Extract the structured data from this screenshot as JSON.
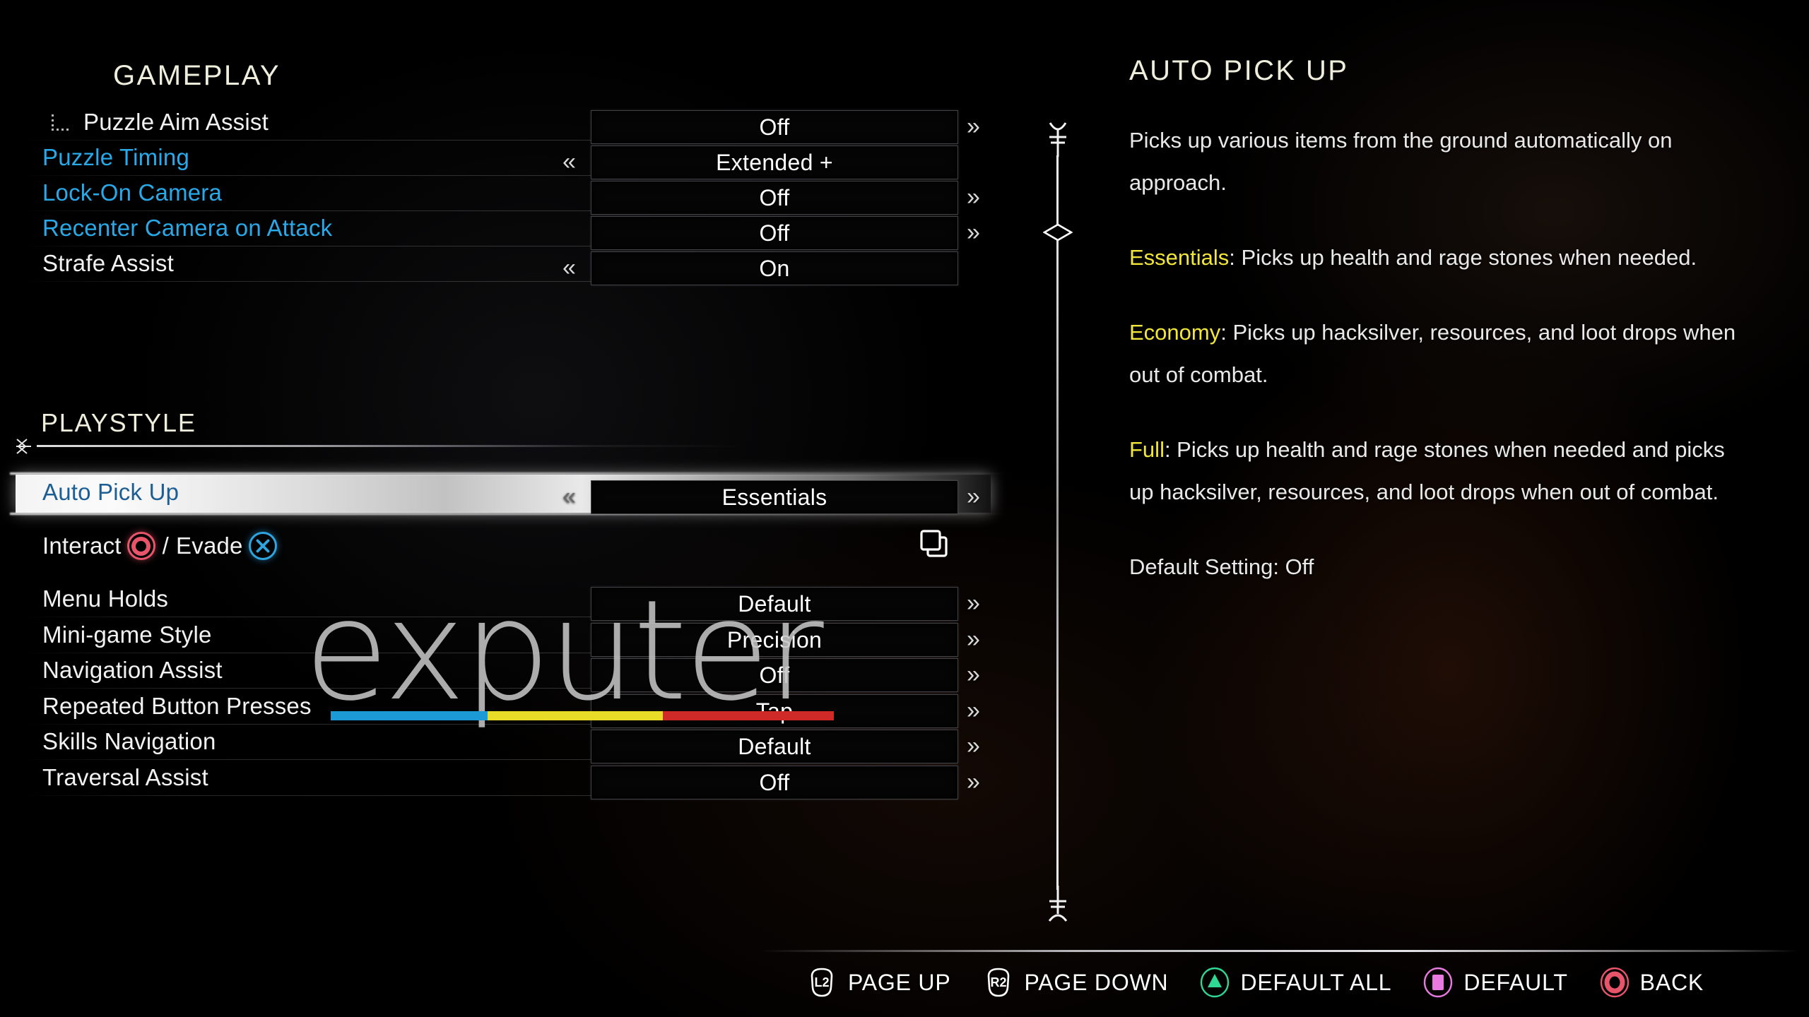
{
  "left": {
    "gameplay_title": "GAMEPLAY",
    "playstyle_title": "PLAYSTYLE",
    "gameplay_rows": [
      {
        "label": "Puzzle Aim Assist",
        "value": "Off",
        "left_arrow": false,
        "right_arrow": true,
        "blue": false,
        "sub": true
      },
      {
        "label": "Puzzle Timing",
        "value": "Extended +",
        "left_arrow": true,
        "right_arrow": false,
        "blue": true,
        "sub": false
      },
      {
        "label": "Lock-On Camera",
        "value": "Off",
        "left_arrow": false,
        "right_arrow": true,
        "blue": true,
        "sub": false
      },
      {
        "label": "Recenter Camera on Attack",
        "value": "Off",
        "left_arrow": false,
        "right_arrow": true,
        "blue": true,
        "sub": false
      },
      {
        "label": "Strafe Assist",
        "value": "On",
        "left_arrow": true,
        "right_arrow": false,
        "blue": false,
        "sub": false
      }
    ],
    "playstyle_rows": [
      {
        "label": "Auto Pick Up",
        "value": "Essentials",
        "left_arrow": true,
        "right_arrow": true,
        "highlight": true
      },
      {
        "label": "Menu Holds",
        "value": "Default",
        "left_arrow": false,
        "right_arrow": true,
        "highlight": false
      },
      {
        "label": "Mini-game Style",
        "value": "Precision",
        "left_arrow": false,
        "right_arrow": true,
        "highlight": false
      },
      {
        "label": "Navigation Assist",
        "value": "Off",
        "left_arrow": false,
        "right_arrow": true,
        "highlight": false
      },
      {
        "label": "Repeated Button Presses",
        "value": "Tap",
        "left_arrow": false,
        "right_arrow": true,
        "highlight": false
      },
      {
        "label": "Skills Navigation",
        "value": "Default",
        "left_arrow": false,
        "right_arrow": true,
        "highlight": false
      },
      {
        "label": "Traversal Assist",
        "value": "Off",
        "left_arrow": false,
        "right_arrow": true,
        "highlight": false
      }
    ],
    "binding_row": {
      "interact_label": "Interact",
      "separator": "/",
      "evade_label": "Evade",
      "interact_icon": "playstation-circle-icon",
      "evade_icon": "playstation-cross-icon",
      "swap_icon": "swap-bindings-icon"
    },
    "left_chevron": "«",
    "right_chevron": "»"
  },
  "description": {
    "title": "AUTO PICK UP",
    "intro": "Picks up various items from the ground automatically on approach.",
    "options": [
      {
        "name": "Essentials",
        "text": ": Picks up health and rage stones when needed."
      },
      {
        "name": "Economy",
        "text": ": Picks up hacksilver, resources, and loot drops when out of combat."
      },
      {
        "name": "Full",
        "text": ": Picks up health and rage stones when needed and picks up hacksilver, resources, and loot drops when out of combat."
      }
    ],
    "default_setting": "Default Setting: Off"
  },
  "footer": {
    "buttons": [
      {
        "icon": "l2-trigger-icon",
        "icon_label": "L2",
        "label": "PAGE UP"
      },
      {
        "icon": "r2-trigger-icon",
        "icon_label": "R2",
        "label": "PAGE DOWN"
      },
      {
        "icon": "playstation-triangle-icon",
        "icon_label": "",
        "label": "DEFAULT ALL"
      },
      {
        "icon": "playstation-square-icon",
        "icon_label": "",
        "label": "DEFAULT"
      },
      {
        "icon": "playstation-circle-icon",
        "icon_label": "",
        "label": "BACK"
      }
    ]
  },
  "scrollbar": {
    "top_cap_icon": "scroll-up-rune-icon",
    "bottom_cap_icon": "scroll-down-rune-icon",
    "thumb_icon": "scroll-thumb-diamond-icon"
  },
  "watermark": {
    "text": "exputer"
  },
  "colors": {
    "accent_blue": "#29a9e8",
    "heading_cream": "#efeedd",
    "keyword_yellow": "#f2e63a",
    "ps_circle_red": "#e8546a",
    "ps_cross_blue": "#2ea4e0",
    "ps_triangle_green": "#2fd694",
    "ps_square_pink": "#e87ae0",
    "watermark_blue": "#1c9ad6",
    "watermark_yellow": "#e8dc28",
    "watermark_red": "#cf2a28"
  }
}
